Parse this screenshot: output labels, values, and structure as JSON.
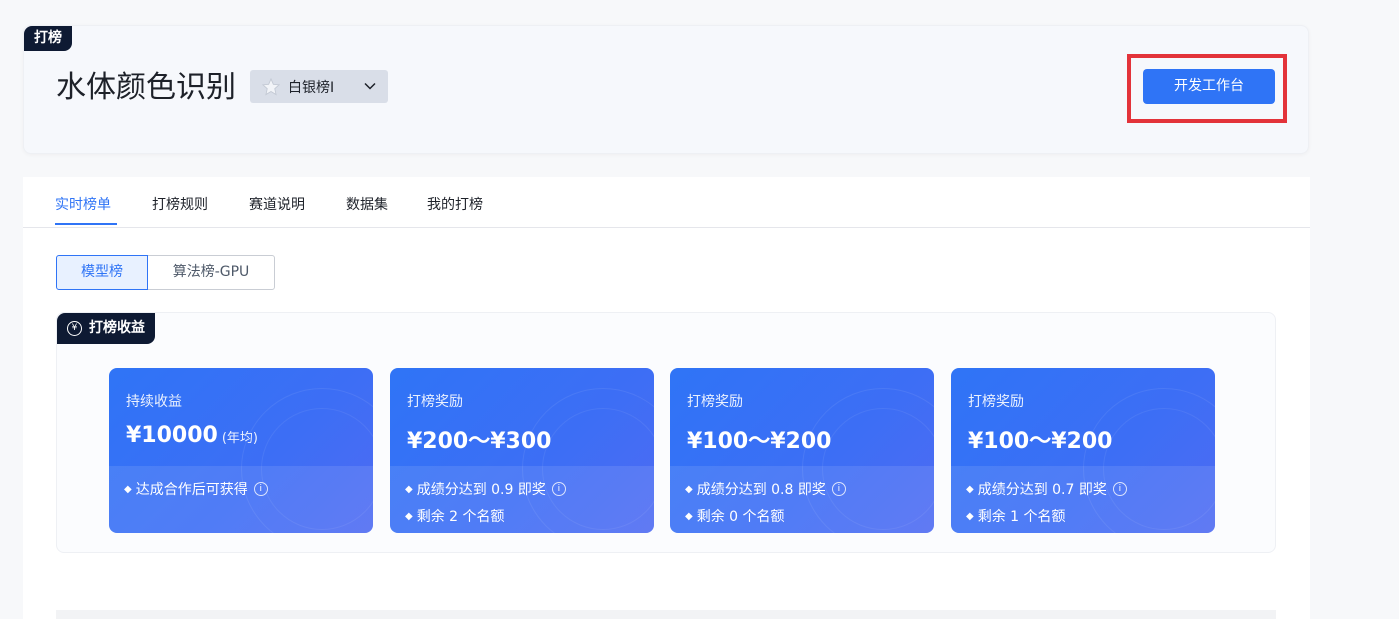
{
  "header": {
    "corner_tag": "打榜",
    "title": "水体颜色识别",
    "tier_label": "白银榜Ⅰ",
    "dev_button": "开发工作台"
  },
  "tabs": [
    {
      "label": "实时榜单",
      "active": true
    },
    {
      "label": "打榜规则",
      "active": false
    },
    {
      "label": "赛道说明",
      "active": false
    },
    {
      "label": "数据集",
      "active": false
    },
    {
      "label": "我的打榜",
      "active": false
    }
  ],
  "segments": [
    {
      "label": "模型榜",
      "active": true
    },
    {
      "label": "算法榜-GPU",
      "active": false
    }
  ],
  "revenue": {
    "tag": "打榜收益",
    "cards": [
      {
        "label": "持续收益",
        "amount": "¥10000",
        "unit": "(年均)",
        "lines": [
          "达成合作后可获得"
        ],
        "info_on_line": 0
      },
      {
        "label": "打榜奖励",
        "amount": "¥200～¥300",
        "unit": "",
        "lines": [
          "成绩分达到 0.9 即奖",
          "剩余 2 个名额"
        ],
        "info_on_line": 0
      },
      {
        "label": "打榜奖励",
        "amount": "¥100～¥200",
        "unit": "",
        "lines": [
          "成绩分达到 0.8 即奖",
          "剩余 0 个名额"
        ],
        "info_on_line": 0
      },
      {
        "label": "打榜奖励",
        "amount": "¥100～¥200",
        "unit": "",
        "lines": [
          "成绩分达到 0.7 即奖",
          "剩余 1 个名额"
        ],
        "info_on_line": 0
      }
    ]
  },
  "colors": {
    "accent": "#2f74f6",
    "highlight_box": "#e3333a",
    "dark_tag": "#0e1a33"
  }
}
